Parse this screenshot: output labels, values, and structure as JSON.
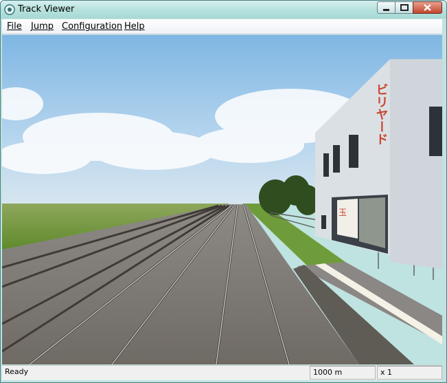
{
  "window": {
    "title": "Track Viewer"
  },
  "menu": {
    "file": "File",
    "jump": "Jump",
    "configuration": "Configuration",
    "help": "Help"
  },
  "scene": {
    "building_sign": "ビリヤード",
    "shop_sign": "玉"
  },
  "status": {
    "state": "Ready",
    "distance": "1000 m",
    "speed": "x 1"
  }
}
